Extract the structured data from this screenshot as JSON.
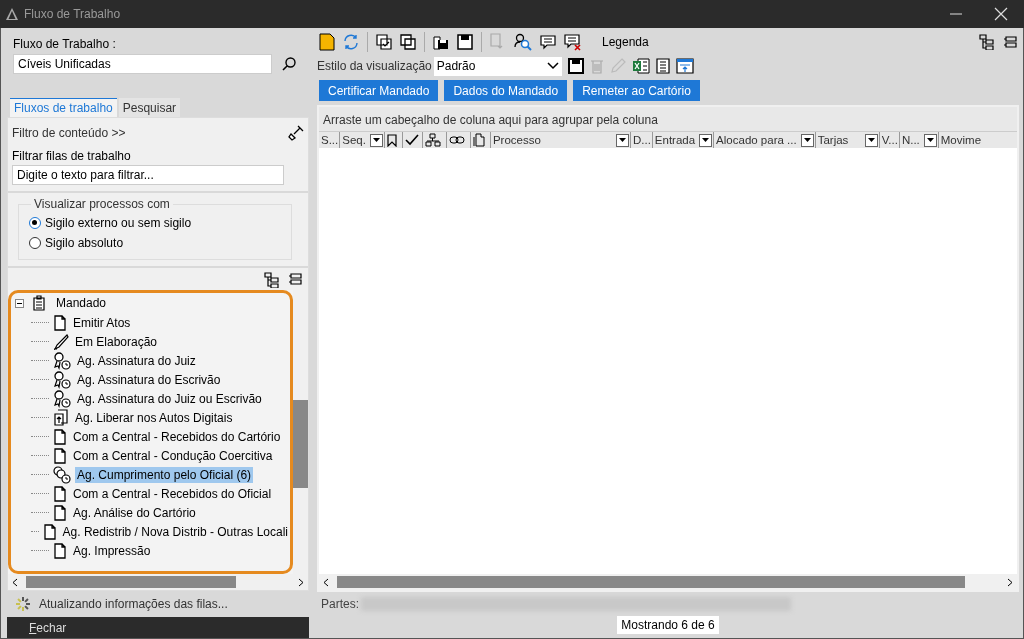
{
  "window": {
    "title": "Fluxo de Trabalho"
  },
  "workflow": {
    "label": "Fluxo de Trabalho :",
    "value": "Cíveis Unificadas"
  },
  "tabs": [
    {
      "label": "Fluxos de trabalho",
      "selected": true
    },
    {
      "label": "Pesquisar",
      "selected": false
    }
  ],
  "content_filter": {
    "label": "Filtro de conteúdo >>"
  },
  "queue_filter": {
    "label": "Filtrar filas de trabalho",
    "placeholder": "Digite o texto para filtrar..."
  },
  "visibility": {
    "legend": "Visualizar processos com",
    "options": [
      {
        "label": "Sigilo externo ou sem sigilo",
        "selected": true
      },
      {
        "label": "Sigilo absoluto",
        "selected": false
      }
    ]
  },
  "tree": [
    {
      "label": "Mandado",
      "expanded": true,
      "children": [
        {
          "label": "Emitir Atos",
          "kind": "page",
          "selected": false
        },
        {
          "label": "Em Elaboração",
          "kind": "pen",
          "selected": false
        },
        {
          "label": "Ag. Assinatura do Juiz",
          "kind": "seal",
          "selected": false
        },
        {
          "label": "Ag. Assinatura do Escrivão",
          "kind": "seal",
          "selected": false
        },
        {
          "label": "Ag. Assinatura do Juiz ou Escrivão",
          "kind": "seal",
          "selected": false
        },
        {
          "label": "Ag. Liberar nos Autos Digitais",
          "kind": "upload",
          "selected": false
        },
        {
          "label": "Com a Central - Recebidos do Cartório",
          "kind": "page",
          "selected": false
        },
        {
          "label": "Com a Central - Condução Coercitiva",
          "kind": "page",
          "selected": false
        },
        {
          "label": "Ag. Cumprimento pelo Oficial (6)",
          "kind": "clock",
          "selected": true
        },
        {
          "label": "Com a Central - Recebidos do Oficial",
          "kind": "page",
          "selected": false
        },
        {
          "label": "Ag. Análise do Cartório",
          "kind": "page",
          "selected": false
        },
        {
          "label": "Ag. Redistrib / Nova Distrib - Outras Locali",
          "kind": "page",
          "selected": false
        },
        {
          "label": "Ag. Impressão",
          "kind": "page",
          "selected": false
        }
      ]
    }
  ],
  "status": {
    "text": "Atualizando informações das filas..."
  },
  "close_button": {
    "label": "Fechar"
  },
  "toolbar": {
    "legend_label": "Legenda"
  },
  "view_style": {
    "label": "Estilo da visualização",
    "value": "Padrão"
  },
  "action_buttons": [
    "Certificar Mandado",
    "Dados do Mandado",
    "Remeter ao Cartório"
  ],
  "grid": {
    "group_hint": "Arraste um cabeçalho de coluna aqui para agrupar pela coluna",
    "columns": [
      {
        "kind": "text",
        "label": "S...",
        "filter": false
      },
      {
        "kind": "text",
        "label": "Seq.",
        "filter": true
      },
      {
        "kind": "bookmark",
        "filter": false
      },
      {
        "kind": "check",
        "filter": false
      },
      {
        "kind": "hierarchy",
        "filter": false
      },
      {
        "kind": "link",
        "filter": false
      },
      {
        "kind": "document",
        "filter": false
      },
      {
        "kind": "text",
        "label": "Processo",
        "filter": true
      },
      {
        "kind": "text",
        "label": "D...",
        "filter": false
      },
      {
        "kind": "text",
        "label": "Entrada",
        "filter": true
      },
      {
        "kind": "text",
        "label": "Alocado para ...",
        "filter": true
      },
      {
        "kind": "text",
        "label": "Tarjas",
        "filter": true
      },
      {
        "kind": "text",
        "label": "V...",
        "filter": false
      },
      {
        "kind": "text",
        "label": "N...",
        "filter": true
      },
      {
        "kind": "text",
        "label": "Movime",
        "filter": false
      }
    ]
  },
  "parties": {
    "label": "Partes:"
  },
  "count": {
    "text": "Mostrando 6 de 6"
  }
}
